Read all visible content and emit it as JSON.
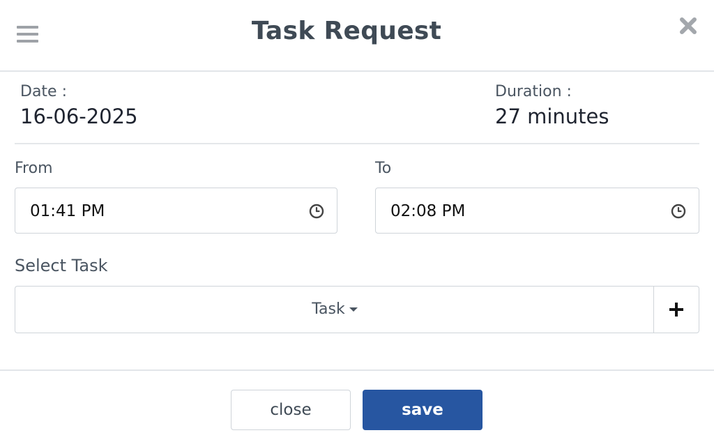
{
  "dialog": {
    "title": "Task Request"
  },
  "info": {
    "date_label": "Date :",
    "date_value": "16-06-2025",
    "duration_label": "Duration :",
    "duration_value": "27 minutes"
  },
  "time": {
    "from_label": "From",
    "from_value": "01:41 PM",
    "to_label": "To",
    "to_value": "02:08 PM"
  },
  "task": {
    "label": "Select Task",
    "dropdown_value": "Task"
  },
  "footer": {
    "close_label": "close",
    "save_label": "save"
  },
  "icons": {
    "menu": "menu-icon",
    "close": "close-icon",
    "clock": "clock-icon",
    "caret": "caret-down-icon",
    "add": "plus-icon"
  },
  "colors": {
    "primary": "#2756a1",
    "title": "#3f4a55",
    "border": "#cfd4d9"
  }
}
